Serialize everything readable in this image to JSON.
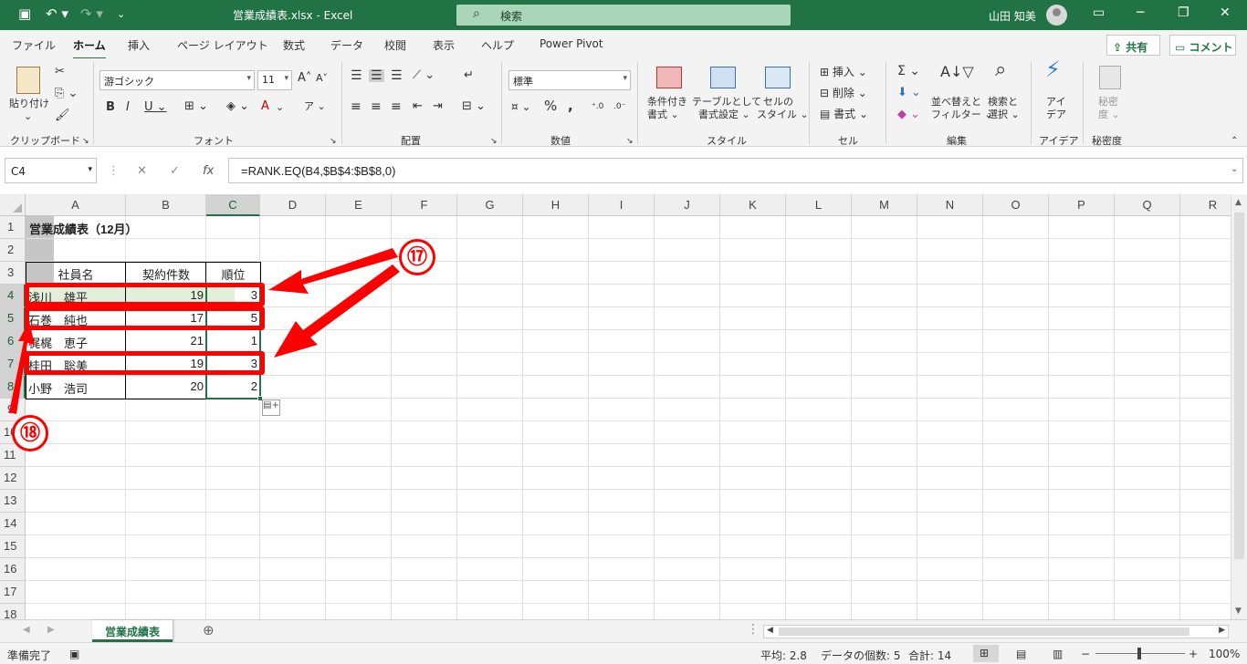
{
  "titlebar": {
    "filename": "営業成績表.xlsx",
    "separator": " - ",
    "app": "Excel",
    "search_placeholder": "検索",
    "user": "山田 知美"
  },
  "ribbon_tabs": [
    "ファイル",
    "ホーム",
    "挿入",
    "ページ レイアウト",
    "数式",
    "データ",
    "校閲",
    "表示",
    "ヘルプ",
    "Power Pivot"
  ],
  "active_tab": "ホーム",
  "share_label": "共有",
  "comment_label": "コメント",
  "ribbon": {
    "paste_label": "貼り付け",
    "font_name": "游ゴシック",
    "font_size": "11",
    "number_format": "標準",
    "cond_format": "条件付き",
    "cond_format2": "書式",
    "table_format": "テーブルとして",
    "table_format2": "書式設定",
    "cell_style": "セルの",
    "cell_style2": "スタイル",
    "insert": "挿入",
    "delete": "削除",
    "format": "書式",
    "sort_filter": "並べ替えと",
    "sort_filter2": "フィルター",
    "find_select": "検索と",
    "find_select2": "選択",
    "ideas": "アイ",
    "ideas2": "デア",
    "sensitivity": "秘密",
    "sensitivity2": "度",
    "groups": [
      "クリップボード",
      "フォント",
      "配置",
      "数値",
      "スタイル",
      "セル",
      "編集",
      "アイデア",
      "秘密度"
    ]
  },
  "formula_bar": {
    "name_box": "C4",
    "formula": "=RANK.EQ(B4,$B$4:$B$8,0)"
  },
  "columns": [
    "A",
    "B",
    "C",
    "D",
    "E",
    "F",
    "G",
    "H",
    "I",
    "J",
    "K",
    "L",
    "M",
    "N",
    "O",
    "P",
    "Q",
    "R"
  ],
  "rows": [
    "1",
    "2",
    "3",
    "4",
    "5",
    "6",
    "7",
    "8",
    "9",
    "10",
    "11",
    "12",
    "13",
    "14",
    "15",
    "16",
    "17",
    "18"
  ],
  "sheet": {
    "title": "営業成績表（12月）",
    "headers": [
      "社員名",
      "契約件数",
      "順位"
    ],
    "data": [
      [
        "浅川　雄平",
        "19",
        "3"
      ],
      [
        "石巻　純也",
        "17",
        "5"
      ],
      [
        "梶梶　恵子",
        "21",
        "1"
      ],
      [
        "桂田　聡美",
        "19",
        "3"
      ],
      [
        "小野　浩司",
        "20",
        "2"
      ]
    ]
  },
  "sheet_tab": "営業成績表",
  "status": {
    "ready": "準備完了",
    "average": "平均: 2.8",
    "count": "データの個数: 5",
    "sum": "合計: 14",
    "zoom": "100%"
  },
  "annotations": {
    "badge_17": "⑰",
    "badge_18": "⑱"
  },
  "colors": {
    "excel_green": "#217346",
    "annotation_red": "#ff0000",
    "header_fill": "#e2efda"
  }
}
